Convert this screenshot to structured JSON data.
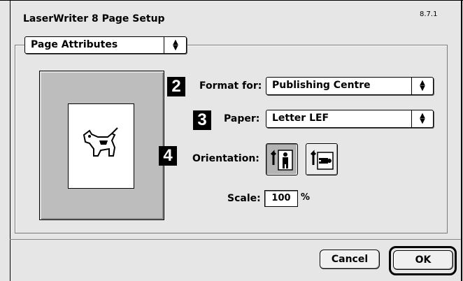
{
  "window": {
    "title": "LaserWriter 8 Page Setup",
    "version": "8.7.1"
  },
  "section_popup": {
    "value": "Page Attributes"
  },
  "steps": {
    "format": "2",
    "paper": "3",
    "orientation": "4"
  },
  "format_for": {
    "label": "Format for:",
    "value": "Publishing Centre"
  },
  "paper": {
    "label": "Paper:",
    "value": "Letter LEF"
  },
  "orientation": {
    "label": "Orientation:",
    "selected": "portrait",
    "options": [
      "portrait-icon",
      "landscape-icon"
    ]
  },
  "scale": {
    "label": "Scale:",
    "value": "100",
    "unit": "%"
  },
  "buttons": {
    "cancel": "Cancel",
    "ok": "OK"
  },
  "colors": {
    "window_bg": "#e6e6e6",
    "preview_bg": "#bdbdbd",
    "step_badge": "#000000"
  }
}
